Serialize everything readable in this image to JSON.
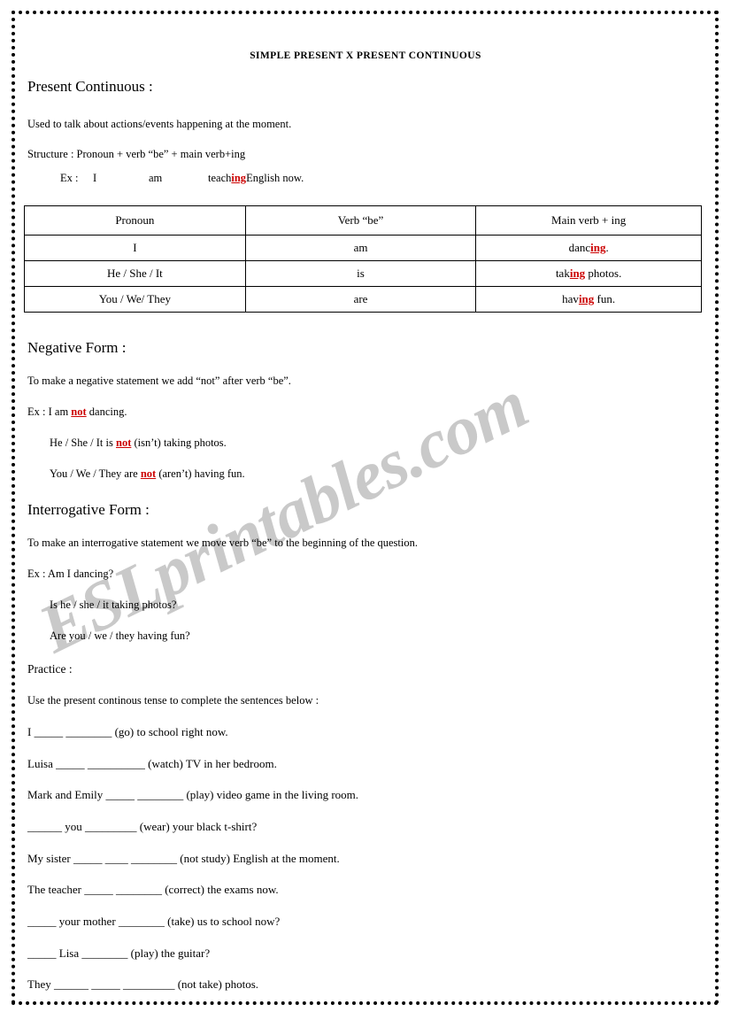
{
  "document": {
    "title": "SIMPLE PRESENT X PRESENT CONTINUOUS",
    "watermark": "ESLprintables.com"
  },
  "present_continuous": {
    "heading": "Present Continuous :",
    "usage": "Used to talk about actions/events happening at the moment.",
    "structure": "Structure : Pronoun + verb “be” + main verb+ing",
    "example": {
      "label": "Ex :",
      "pronoun": "I",
      "verb_be": "am",
      "main_verb_stem": "teach",
      "main_verb_suffix": "ing",
      "rest": "English now."
    }
  },
  "table": {
    "headers": [
      "Pronoun",
      "Verb “be”",
      "Main verb + ing"
    ],
    "rows": [
      {
        "pronoun": "I",
        "verb_be": "am",
        "main_stem": "danc",
        "main_suffix": "ing",
        "main_rest": "."
      },
      {
        "pronoun": "He / She / It",
        "verb_be": "is",
        "main_stem": "tak",
        "main_suffix": "ing",
        "main_rest": " photos."
      },
      {
        "pronoun": "You / We/ They",
        "verb_be": "are",
        "main_stem": "hav",
        "main_suffix": "ing",
        "main_rest": " fun."
      }
    ]
  },
  "negative": {
    "heading": "Negative Form :",
    "rule": "To make a negative statement we add “not” after verb “be”.",
    "examples": [
      {
        "before": "Ex : I  am ",
        "not": "not",
        "after": " dancing."
      },
      {
        "before": "He / She / It is ",
        "not": "not",
        "after": " (isn’t) taking photos."
      },
      {
        "before": "You / We / They are ",
        "not": "not",
        "after": " (aren’t) having fun."
      }
    ]
  },
  "interrogative": {
    "heading": "Interrogative Form :",
    "rule": "To make an interrogative statement we move verb “be” to the beginning of the question.",
    "examples": [
      "Ex : Am I dancing?",
      "Is he / she / it taking photos?",
      "Are you / we / they having fun?"
    ]
  },
  "practice": {
    "heading": "Practice :",
    "instruction": "Use the present continous tense to complete the sentences below :",
    "items": [
      "I _____  ________ (go) to school right now.",
      "Luisa _____ __________ (watch) TV in her bedroom.",
      "Mark and Emily _____ ________ (play) video game in the living room.",
      "______ you _________ (wear) your black t-shirt?",
      "My sister _____ ____ ________ (not study) English at the moment.",
      "The teacher _____ ________ (correct) the exams now.",
      "_____ your mother ________ (take) us to school now?",
      "_____ Lisa ________ (play) the guitar?",
      "They ______ _____ _________ (not take) photos."
    ]
  }
}
